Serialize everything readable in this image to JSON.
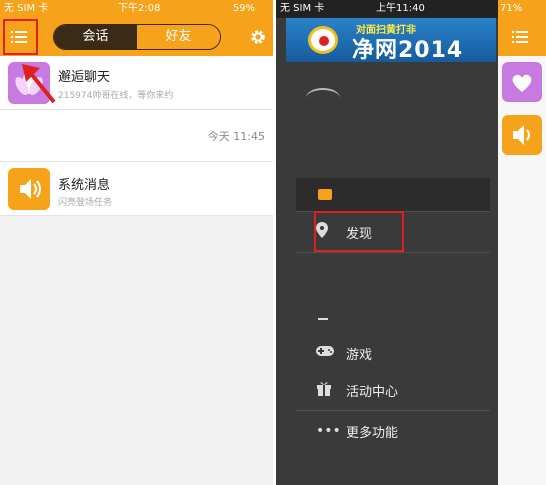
{
  "left": {
    "status": {
      "carrier": "无 SIM 卡",
      "time": "下午2:08",
      "battery": "59%"
    },
    "tabs": [
      {
        "label": "会话",
        "active": true
      },
      {
        "label": "好友",
        "active": false
      }
    ],
    "conversations": [
      {
        "title": "邂逅聊天",
        "subtitle": "215974帅哥在线，等你来约",
        "icon": "flower-icon",
        "color": "#c77be0"
      },
      {
        "time": "今天 11:45"
      },
      {
        "title": "系统消息",
        "subtitle": "闪亮登场任务",
        "icon": "speaker-icon",
        "color": "#f7a21b"
      }
    ]
  },
  "right": {
    "status": {
      "carrier": "无 SIM 卡",
      "time": "上午11:40",
      "battery": "71%"
    },
    "banner": {
      "small": "对面扫黄打非",
      "big": "净网2014"
    },
    "menu": [
      {
        "icon": "chat-icon",
        "label": ""
      },
      {
        "icon": "location-pin-icon",
        "label": "发现"
      },
      {
        "icon": "gamepad-icon",
        "label": "游戏"
      },
      {
        "icon": "gift-icon",
        "label": "活动中心"
      },
      {
        "icon": "more-dots-icon",
        "label": "更多功能"
      }
    ]
  },
  "colors": {
    "accent": "#f7a21b",
    "highlight": "#e02020",
    "drawer": "#3a3a3a"
  }
}
